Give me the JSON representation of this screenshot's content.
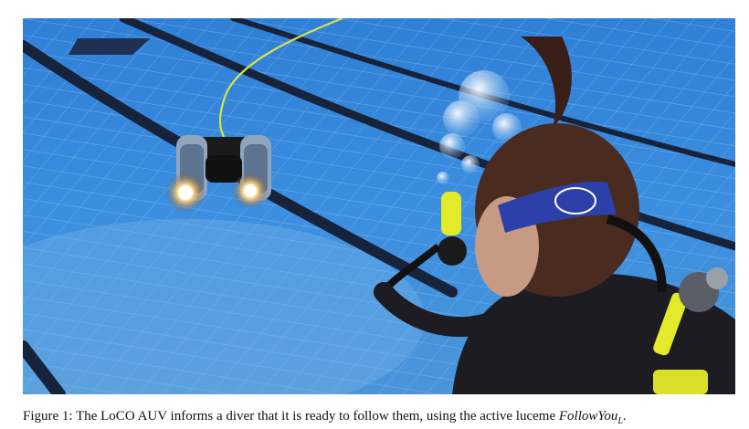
{
  "figure": {
    "caption_prefix": "Figure 1:",
    "caption_text": "The LoCO AUV informs a diver that it is ready to follow them, using the active luceme",
    "luceme_name": "FollowYou",
    "luceme_subscript": "L",
    "caption_suffix": ".",
    "colors": {
      "pool_water": "#3a86d4",
      "lane_line": "#1b2a44",
      "tether": "#d7e24a",
      "wetsuit": "#1c1c22",
      "headband": "#2d3fa8",
      "mask_frame": "#e3ea2a"
    }
  }
}
